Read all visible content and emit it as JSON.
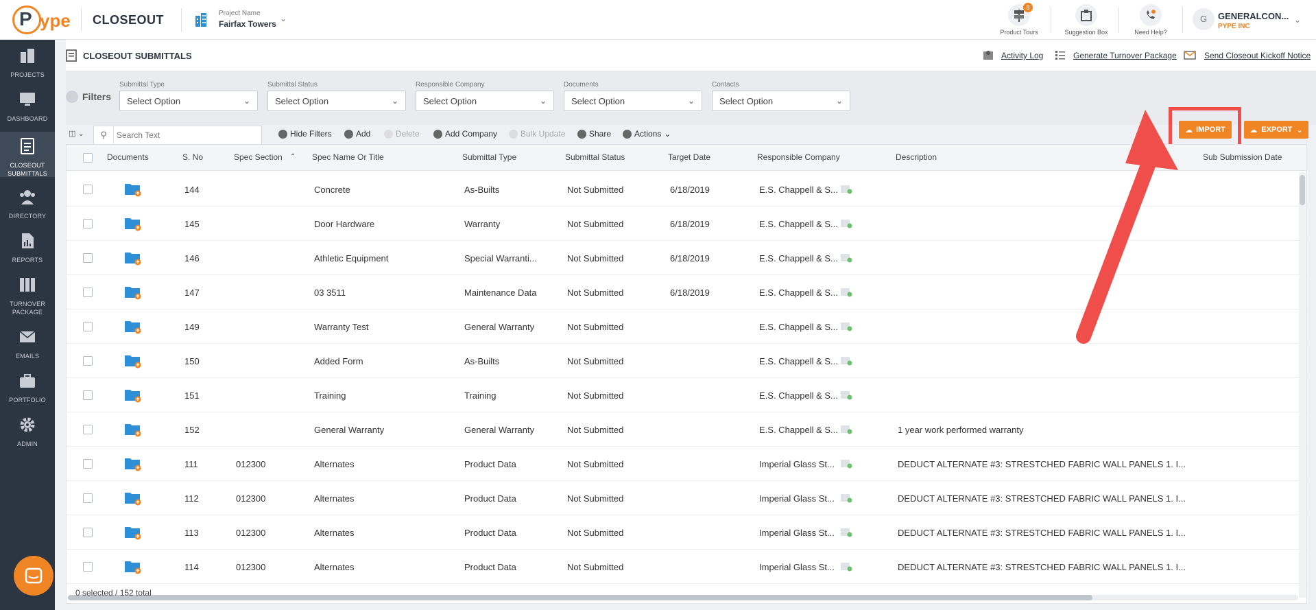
{
  "app": {
    "logo_p": "P",
    "logo_ype": "ype",
    "module_title": "CLOSEOUT",
    "project_label": "Project Name",
    "project_name": "Fairfax Towers"
  },
  "top_tools": [
    {
      "label": "Product Tours",
      "badge": "8"
    },
    {
      "label": "Suggestion Box"
    },
    {
      "label": "Need Help?"
    }
  ],
  "user": {
    "avatar_letter": "G",
    "name": "GENERALCON...",
    "org": "PYPE INC"
  },
  "sidebar": {
    "items": [
      {
        "label": "PROJECTS"
      },
      {
        "label": "DASHBOARD"
      },
      {
        "label": "CLOSEOUT SUBMITTALS",
        "label_line1": "CLOSEOUT",
        "label_line2": "SUBMITTALS",
        "active": true
      },
      {
        "label": "DIRECTORY"
      },
      {
        "label": "REPORTS"
      },
      {
        "label": "TURNOVER PACKAGE",
        "label_line1": "TURNOVER",
        "label_line2": "PACKAGE"
      },
      {
        "label": "EMAILS"
      },
      {
        "label": "PORTFOLIO"
      },
      {
        "label": "ADMIN"
      }
    ]
  },
  "page": {
    "title": "CLOSEOUT SUBMITTALS",
    "links": {
      "activity_log": "Activity Log",
      "generate_turnover": "Generate Turnover Package",
      "send_kickoff": "Send Closeout Kickoff Notice"
    }
  },
  "filters": {
    "label": "Filters",
    "groups": [
      {
        "label": "Submittal Type",
        "value": "Select Option"
      },
      {
        "label": "Submittal Status",
        "value": "Select Option"
      },
      {
        "label": "Responsible Company",
        "value": "Select Option"
      },
      {
        "label": "Documents",
        "value": "Select Option"
      },
      {
        "label": "Contacts",
        "value": "Select Option"
      }
    ]
  },
  "toolbar": {
    "search_placeholder": "Search Text",
    "hide_filters": "Hide Filters",
    "add": "Add",
    "delete": "Delete",
    "add_company": "Add Company",
    "bulk_update": "Bulk Update",
    "share": "Share",
    "actions": "Actions",
    "import": "IMPORT",
    "export": "EXPORT"
  },
  "table": {
    "columns": [
      "Documents",
      "S. No",
      "Spec Section",
      "Spec Name Or Title",
      "Submittal Type",
      "Submittal Status",
      "Target Date",
      "Responsible Company",
      "Description",
      "Sub Submission Date"
    ],
    "rows": [
      {
        "sno": "144",
        "spec_section": "",
        "title": "Concrete",
        "type": "As-Builts",
        "status": "Not Submitted",
        "target": "6/18/2019",
        "company": "E.S. Chappell & S...",
        "description": ""
      },
      {
        "sno": "145",
        "spec_section": "",
        "title": "Door Hardware",
        "type": "Warranty",
        "status": "Not Submitted",
        "target": "6/18/2019",
        "company": "E.S. Chappell & S...",
        "description": ""
      },
      {
        "sno": "146",
        "spec_section": "",
        "title": "Athletic Equipment",
        "type": "Special Warranti...",
        "status": "Not Submitted",
        "target": "6/18/2019",
        "company": "E.S. Chappell & S...",
        "description": ""
      },
      {
        "sno": "147",
        "spec_section": "",
        "title": "03 3511",
        "type": "Maintenance Data",
        "status": "Not Submitted",
        "target": "6/18/2019",
        "company": "E.S. Chappell & S...",
        "description": ""
      },
      {
        "sno": "149",
        "spec_section": "",
        "title": "Warranty Test",
        "type": "General Warranty",
        "status": "Not Submitted",
        "target": "",
        "company": "E.S. Chappell & S...",
        "description": ""
      },
      {
        "sno": "150",
        "spec_section": "",
        "title": "Added Form",
        "type": "As-Builts",
        "status": "Not Submitted",
        "target": "",
        "company": "E.S. Chappell & S...",
        "description": ""
      },
      {
        "sno": "151",
        "spec_section": "",
        "title": "Training",
        "type": "Training",
        "status": "Not Submitted",
        "target": "",
        "company": "E.S. Chappell & S...",
        "description": ""
      },
      {
        "sno": "152",
        "spec_section": "",
        "title": "General Warranty",
        "type": "General Warranty",
        "status": "Not Submitted",
        "target": "",
        "company": "E.S. Chappell & S...",
        "description": "1 year work performed warranty"
      },
      {
        "sno": "111",
        "spec_section": "012300",
        "title": "Alternates",
        "type": "Product Data",
        "status": "Not Submitted",
        "target": "",
        "company": "Imperial Glass St...",
        "description": "DEDUCT ALTERNATE #3: STRESTCHED FABRIC WALL PANELS 1. I..."
      },
      {
        "sno": "112",
        "spec_section": "012300",
        "title": "Alternates",
        "type": "Product Data",
        "status": "Not Submitted",
        "target": "",
        "company": "Imperial Glass St...",
        "description": "DEDUCT ALTERNATE #3: STRESTCHED FABRIC WALL PANELS 1. I..."
      },
      {
        "sno": "113",
        "spec_section": "012300",
        "title": "Alternates",
        "type": "Product Data",
        "status": "Not Submitted",
        "target": "",
        "company": "Imperial Glass St...",
        "description": "DEDUCT ALTERNATE #3: STRESTCHED FABRIC WALL PANELS 1. I..."
      },
      {
        "sno": "114",
        "spec_section": "012300",
        "title": "Alternates",
        "type": "Product Data",
        "status": "Not Submitted",
        "target": "",
        "company": "Imperial Glass St...",
        "description": "DEDUCT ALTERNATE #3: STRESTCHED FABRIC WALL PANELS 1. I..."
      }
    ]
  },
  "footer": {
    "status": "0 selected / 152 total"
  },
  "colors": {
    "accent": "#f08526",
    "sidebar": "#2c3542",
    "highlight": "#f04e4a"
  }
}
